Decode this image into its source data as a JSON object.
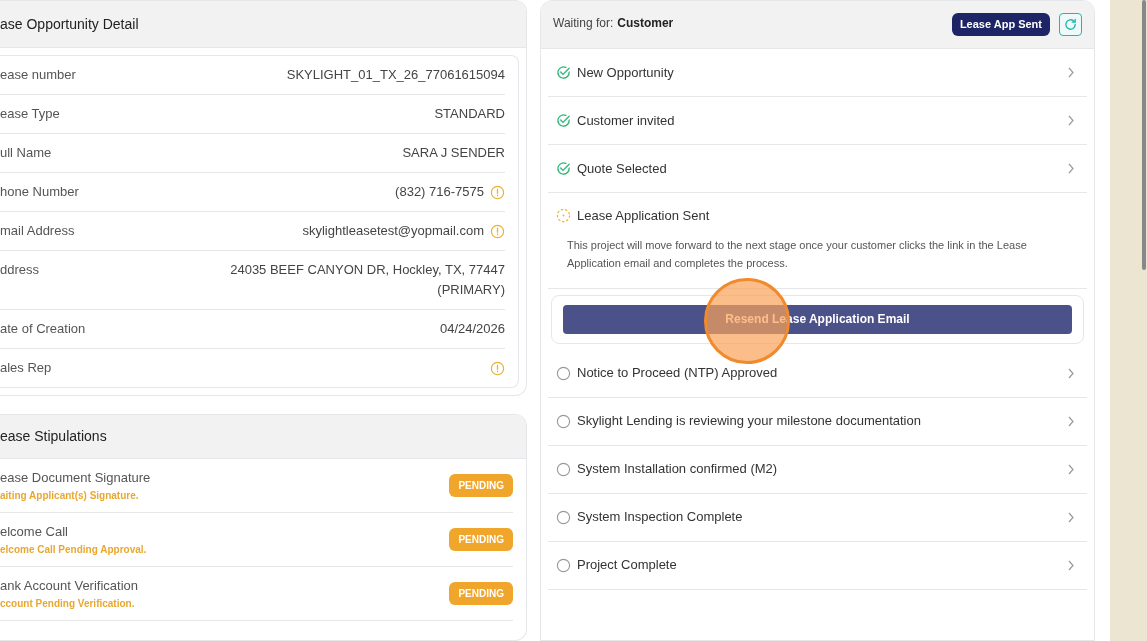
{
  "detail_panel": {
    "title": "ase Opportunity Detail",
    "fields": [
      {
        "label": "ease number",
        "value": "SKYLIGHT_01_TX_26_77061615094",
        "warning": false
      },
      {
        "label": "ease Type",
        "value": "STANDARD",
        "warning": false
      },
      {
        "label": "ull Name",
        "value": "SARA J SENDER",
        "warning": false
      },
      {
        "label": "hone Number",
        "value": "(832) 716-7575",
        "warning": true
      },
      {
        "label": "mail Address",
        "value": "skylightleasetest@yopmail.com",
        "warning": true
      },
      {
        "label": "ddress",
        "value": "24035 BEEF CANYON DR, Hockley, TX, 77447 (PRIMARY)",
        "warning": false
      },
      {
        "label": "ate of Creation",
        "value": "04/24/2026",
        "warning": false
      },
      {
        "label": "ales Rep",
        "warning": true
      }
    ]
  },
  "stipulations_panel": {
    "title": "ease Stipulations",
    "items": [
      {
        "title": "ease Document Signature",
        "note": "aiting Applicant(s) Signature.",
        "badge": "PENDING"
      },
      {
        "title": "elcome Call",
        "note": "elcome Call Pending Approval.",
        "badge": "PENDING"
      },
      {
        "title": "ank Account Verification",
        "note": "ccount Pending Verification.",
        "badge": "PENDING"
      }
    ]
  },
  "progress_panel": {
    "waiting_label": "Waiting for:",
    "waiting_for": "Customer",
    "status_badge": "Lease App Sent",
    "steps": [
      {
        "label": "New Opportunity",
        "kind": "done"
      },
      {
        "label": "Customer invited",
        "kind": "done"
      },
      {
        "label": "Quote Selected",
        "kind": "done"
      },
      {
        "label": "Lease Application Sent",
        "kind": "current",
        "description": "This project will move forward to the next stage once your customer clicks the link in the Lease Application email and completes the process.",
        "action": "Resend Lease Application Email"
      },
      {
        "label": "Notice to Proceed (NTP) Approved",
        "kind": "pending"
      },
      {
        "label": "Skylight Lending is reviewing your milestone documentation",
        "kind": "pending"
      },
      {
        "label": "System Installation confirmed (M2)",
        "kind": "pending"
      },
      {
        "label": "System Inspection Complete",
        "kind": "pending"
      },
      {
        "label": "Project Complete",
        "kind": "pending"
      }
    ]
  }
}
